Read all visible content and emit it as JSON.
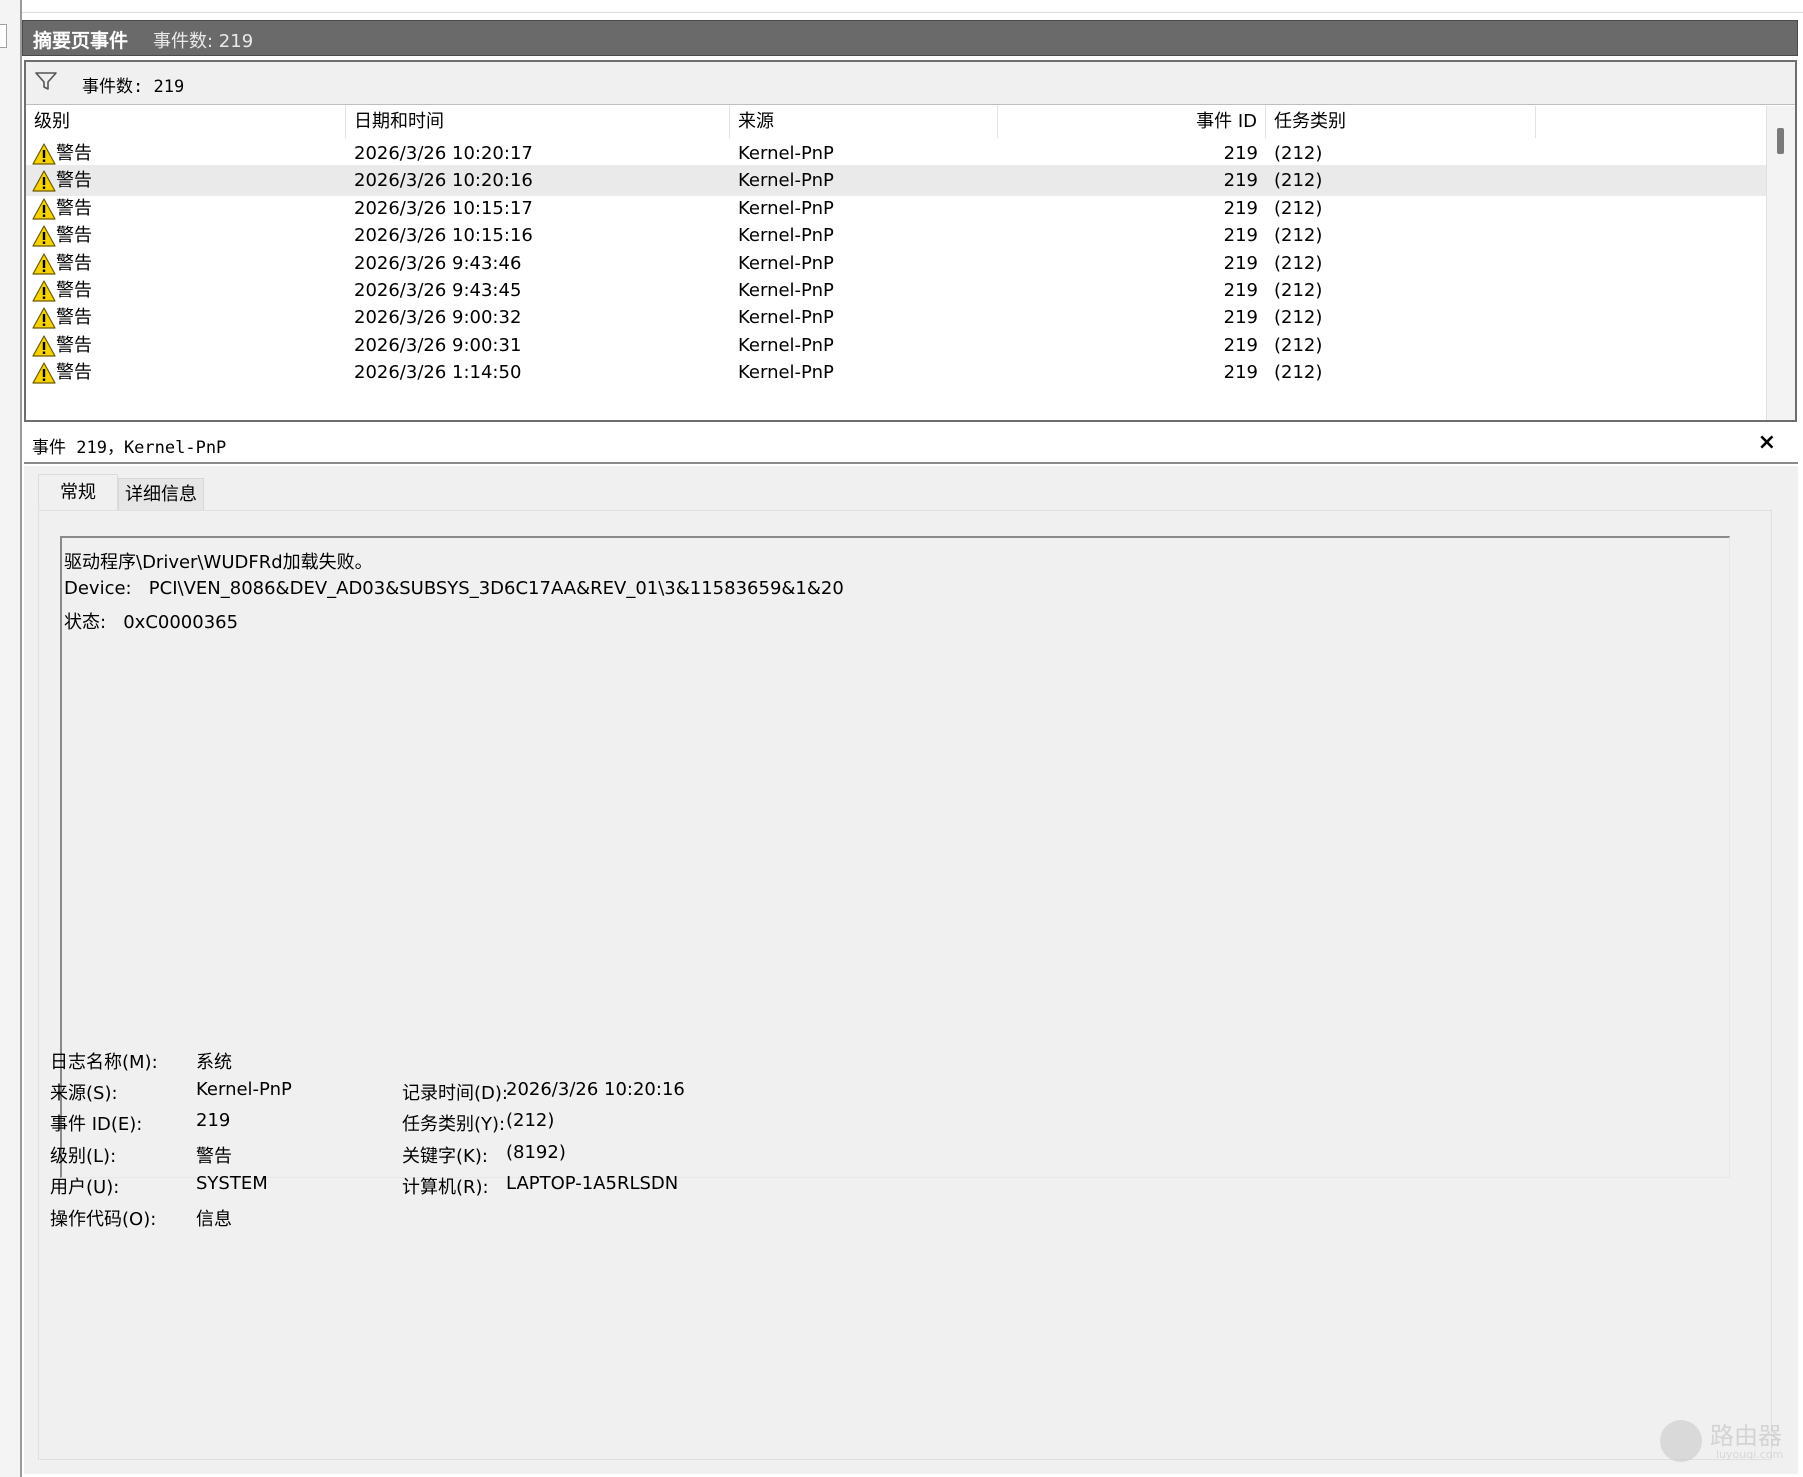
{
  "header": {
    "title": "摘要页事件",
    "count_label": "事件数: 219"
  },
  "filter": {
    "count_label": "事件数: 219",
    "icon": "filter-icon"
  },
  "columns": [
    "级别",
    "日期和时间",
    "来源",
    "事件 ID",
    "任务类别"
  ],
  "events": [
    {
      "level": "警告",
      "datetime": "2026/3/26 10:20:17",
      "source": "Kernel-PnP",
      "event_id": "219",
      "task_category": "(212)"
    },
    {
      "level": "警告",
      "datetime": "2026/3/26 10:20:16",
      "source": "Kernel-PnP",
      "event_id": "219",
      "task_category": "(212)"
    },
    {
      "level": "警告",
      "datetime": "2026/3/26 10:15:17",
      "source": "Kernel-PnP",
      "event_id": "219",
      "task_category": "(212)"
    },
    {
      "level": "警告",
      "datetime": "2026/3/26 10:15:16",
      "source": "Kernel-PnP",
      "event_id": "219",
      "task_category": "(212)"
    },
    {
      "level": "警告",
      "datetime": "2026/3/26 9:43:46",
      "source": "Kernel-PnP",
      "event_id": "219",
      "task_category": "(212)"
    },
    {
      "level": "警告",
      "datetime": "2026/3/26 9:43:45",
      "source": "Kernel-PnP",
      "event_id": "219",
      "task_category": "(212)"
    },
    {
      "level": "警告",
      "datetime": "2026/3/26 9:00:32",
      "source": "Kernel-PnP",
      "event_id": "219",
      "task_category": "(212)"
    },
    {
      "level": "警告",
      "datetime": "2026/3/26 9:00:31",
      "source": "Kernel-PnP",
      "event_id": "219",
      "task_category": "(212)"
    },
    {
      "level": "警告",
      "datetime": "2026/3/26 1:14:50",
      "source": "Kernel-PnP",
      "event_id": "219",
      "task_category": "(212)"
    }
  ],
  "detail": {
    "title": "事件 219，Kernel-PnP",
    "close_glyph": "×",
    "tabs": [
      "常规",
      "详细信息"
    ],
    "message": [
      "驱动程序\\Driver\\WUDFRd加载失败。",
      "Device:   PCI\\VEN_8086&DEV_AD03&SUBSYS_3D6C17AA&REV_01\\3&11583659&1&20",
      "状态:   0xC0000365"
    ],
    "fields": {
      "log_name_label": "日志名称(M):",
      "log_name": "系统",
      "source_label": "来源(S):",
      "source": "Kernel-PnP",
      "logged_label": "记录时间(D):",
      "logged": "2026/3/26 10:20:16",
      "event_id_label": "事件 ID(E):",
      "event_id": "219",
      "task_label": "任务类别(Y):",
      "task": "(212)",
      "level_label": "级别(L):",
      "level": "警告",
      "keywords_label": "关键字(K):",
      "keywords": "(8192)",
      "user_label": "用户(U):",
      "user": "SYSTEM",
      "computer_label": "计算机(R):",
      "computer": "LAPTOP-1A5RLSDN",
      "opcode_label": "操作代码(O):",
      "opcode": "信息"
    }
  },
  "watermark": {
    "text": "路由器",
    "sub": "luyouqi.com"
  },
  "colors": {
    "header_bg": "#6a6a6a",
    "warning_yellow": "#f6d200",
    "selected_row": "#eaeaea"
  }
}
